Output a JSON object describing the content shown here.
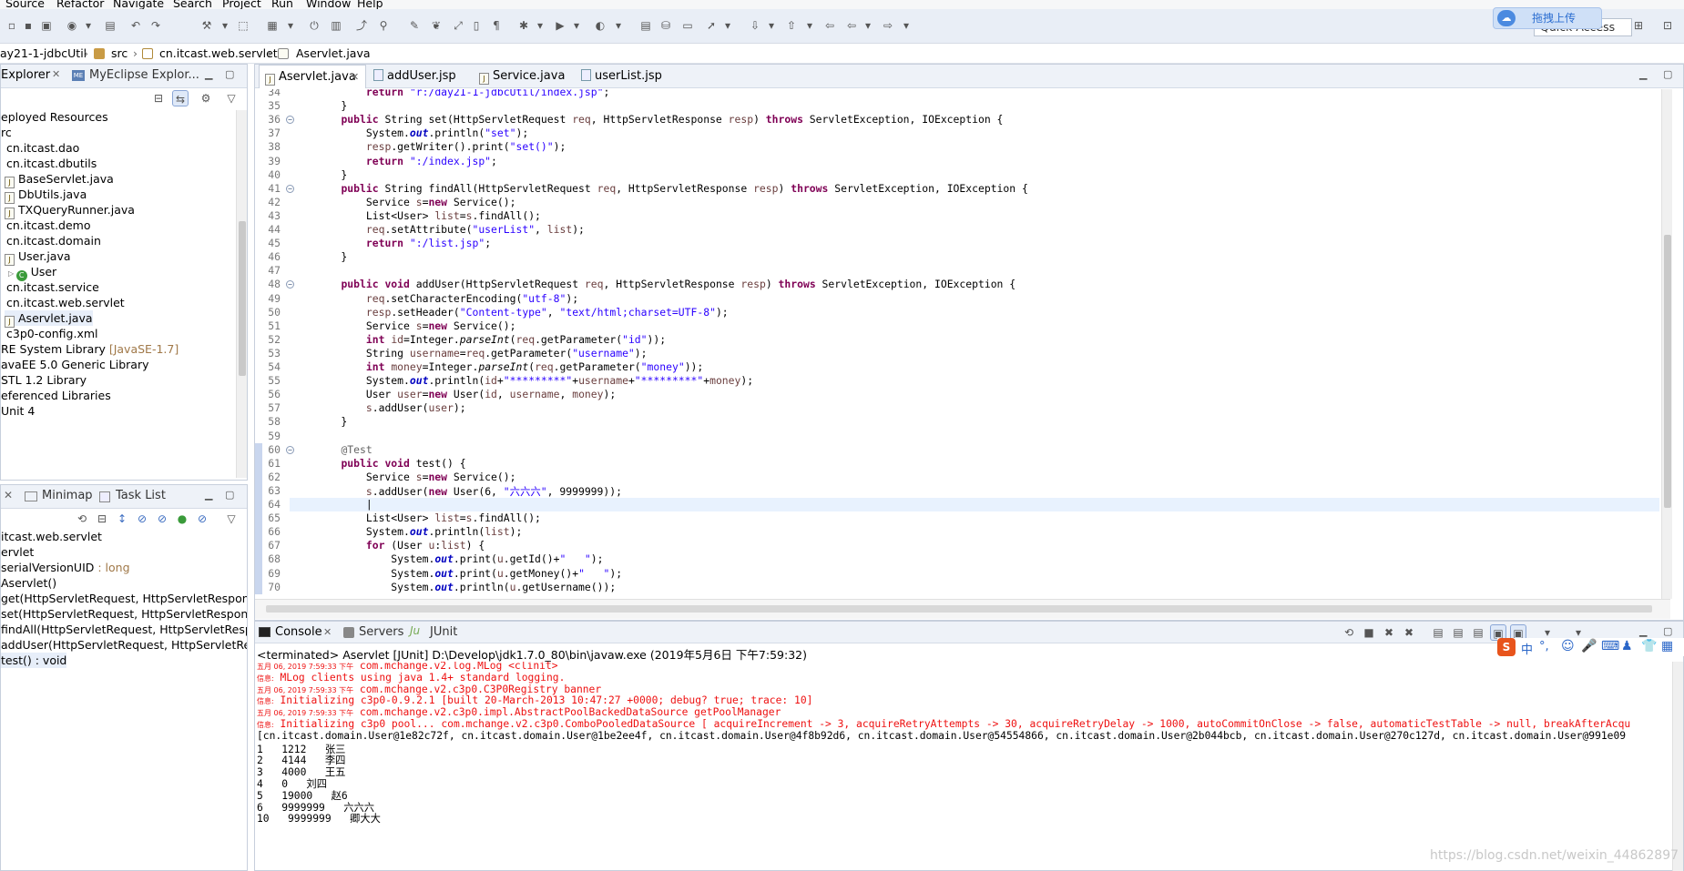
{
  "menu": [
    "Source",
    "Refactor",
    "Navigate",
    "Search",
    "Project",
    "Run",
    "Window",
    "Help"
  ],
  "quick_access": "Quick Access",
  "upload_label": "拖拽上传",
  "breadcrumb": [
    "ay21-1-jdbcUtil",
    "src",
    "cn.itcast.web.servlet",
    "Aservlet.java"
  ],
  "explorer": {
    "tabs": [
      "Explorer",
      "MyEclipse Explor..."
    ],
    "items": [
      {
        "label": "eployed Resources",
        "indent": 0,
        "icon": "none"
      },
      {
        "label": "rc",
        "indent": 0,
        "icon": "none"
      },
      {
        "label": "cn.itcast.dao",
        "indent": 6,
        "icon": "none"
      },
      {
        "label": "cn.itcast.dbutils",
        "indent": 6,
        "icon": "none"
      },
      {
        "label": "BaseServlet.java",
        "indent": 4,
        "icon": "java"
      },
      {
        "label": "DbUtils.java",
        "indent": 4,
        "icon": "java"
      },
      {
        "label": "TXQueryRunner.java",
        "indent": 4,
        "icon": "java"
      },
      {
        "label": "cn.itcast.demo",
        "indent": 6,
        "icon": "none"
      },
      {
        "label": "cn.itcast.domain",
        "indent": 6,
        "icon": "none"
      },
      {
        "label": "User.java",
        "indent": 4,
        "icon": "java"
      },
      {
        "label": "User",
        "indent": 8,
        "icon": "class"
      },
      {
        "label": "cn.itcast.service",
        "indent": 6,
        "icon": "none"
      },
      {
        "label": "cn.itcast.web.servlet",
        "indent": 6,
        "icon": "none"
      },
      {
        "label": "Aservlet.java",
        "indent": 4,
        "icon": "java",
        "selected": true
      },
      {
        "label": "c3p0-config.xml",
        "indent": 6,
        "icon": "none"
      },
      {
        "label": "RE System Library",
        "suffix": " [JavaSE-1.7]",
        "indent": 0,
        "icon": "none"
      },
      {
        "label": "avaEE 5.0 Generic Library",
        "indent": 0,
        "icon": "none"
      },
      {
        "label": "STL 1.2 Library",
        "indent": 0,
        "icon": "none"
      },
      {
        "label": "eferenced Libraries",
        "indent": 0,
        "icon": "none"
      },
      {
        "label": "Unit 4",
        "indent": 0,
        "icon": "none"
      }
    ]
  },
  "outline": {
    "tabs": [
      "Minimap",
      "Task List"
    ],
    "items": [
      {
        "label": "itcast.web.servlet",
        "suffix": ""
      },
      {
        "label": "ervlet",
        "suffix": ""
      },
      {
        "label": "serialVersionUID",
        "suffix": " : long"
      },
      {
        "label": "Aservlet()",
        "suffix": ""
      },
      {
        "label": "get(HttpServletRequest, HttpServletResponse)",
        "suffix": ""
      },
      {
        "label": "set(HttpServletRequest, HttpServletResponse)",
        "suffix": ""
      },
      {
        "label": "findAll(HttpServletRequest, HttpServletRespon",
        "suffix": ""
      },
      {
        "label": "addUser(HttpServletRequest, HttpServletRespo",
        "suffix": ""
      },
      {
        "label": "test() : void",
        "suffix": "",
        "selected": true
      }
    ]
  },
  "editor": {
    "tabs": [
      "Aservlet.java",
      "addUser.jsp",
      "Service.java",
      "userList.jsp"
    ],
    "lines": [
      {
        "n": "34",
        "html": "        <span class='kw'>return</span> <span class='str'>\"r:/day21-1-jdbcUtil/index.jsp\"</span>;"
      },
      {
        "n": "35",
        "html": "    }"
      },
      {
        "n": "36",
        "fold": true,
        "html": "    <span class='kw'>public</span> String set(HttpServletRequest <span class='var'>req</span>, HttpServletResponse <span class='var'>resp</span>) <span class='kw'>throws</span> ServletException, IOException {"
      },
      {
        "n": "37",
        "html": "        System.<span class='fld'>out</span>.println(<span class='str'>\"set\"</span>);"
      },
      {
        "n": "38",
        "html": "        <span class='var'>resp</span>.getWriter().print(<span class='str'>\"set()\"</span>);"
      },
      {
        "n": "39",
        "html": "        <span class='kw'>return</span> <span class='str'>\":/index.jsp\"</span>;"
      },
      {
        "n": "40",
        "html": "    }"
      },
      {
        "n": "41",
        "fold": true,
        "html": "    <span class='kw'>public</span> String findAll(HttpServletRequest <span class='var'>req</span>, HttpServletResponse <span class='var'>resp</span>) <span class='kw'>throws</span> ServletException, IOException {"
      },
      {
        "n": "42",
        "html": "        Service <span class='var'>s</span>=<span class='kw'>new</span> Service();"
      },
      {
        "n": "43",
        "html": "        List&lt;User&gt; <span class='var'>list</span>=<span class='var'>s</span>.findAll();"
      },
      {
        "n": "44",
        "html": "        <span class='var'>req</span>.setAttribute(<span class='str'>\"userList\"</span>, <span class='var'>list</span>);"
      },
      {
        "n": "45",
        "html": "        <span class='kw'>return</span> <span class='str'>\":/list.jsp\"</span>;"
      },
      {
        "n": "46",
        "html": "    }"
      },
      {
        "n": "47",
        "html": ""
      },
      {
        "n": "48",
        "fold": true,
        "html": "    <span class='kw'>public</span> <span class='kw'>void</span> addUser(HttpServletRequest <span class='var'>req</span>, HttpServletResponse <span class='var'>resp</span>) <span class='kw'>throws</span> ServletException, IOException {"
      },
      {
        "n": "49",
        "html": "        <span class='var'>req</span>.setCharacterEncoding(<span class='str'>\"utf-8\"</span>);"
      },
      {
        "n": "50",
        "html": "        <span class='var'>resp</span>.setHeader(<span class='str'>\"Content-type\"</span>, <span class='str'>\"text/html;charset=UTF-8\"</span>);"
      },
      {
        "n": "51",
        "html": "        Service <span class='var'>s</span>=<span class='kw'>new</span> Service();"
      },
      {
        "n": "52",
        "html": "        <span class='kw'>int</span> <span class='var'>id</span>=Integer.<span class='ital'>parseInt</span>(<span class='var'>req</span>.getParameter(<span class='str'>\"id\"</span>));"
      },
      {
        "n": "53",
        "html": "        String <span class='var'>username</span>=<span class='var'>req</span>.getParameter(<span class='str'>\"username\"</span>);"
      },
      {
        "n": "54",
        "html": "        <span class='kw'>int</span> <span class='var'>money</span>=Integer.<span class='ital'>parseInt</span>(<span class='var'>req</span>.getParameter(<span class='str'>\"money\"</span>));"
      },
      {
        "n": "55",
        "html": "        System.<span class='fld'>out</span>.println(<span class='var'>id</span>+<span class='str'>\"*********\"</span>+<span class='var'>username</span>+<span class='str'>\"*********\"</span>+<span class='var'>money</span>);"
      },
      {
        "n": "56",
        "html": "        User <span class='var'>user</span>=<span class='kw'>new</span> User(<span class='var'>id</span>, <span class='var'>username</span>, <span class='var'>money</span>);"
      },
      {
        "n": "57",
        "html": "        <span class='var'>s</span>.addUser(<span class='var'>user</span>);"
      },
      {
        "n": "58",
        "html": "    }"
      },
      {
        "n": "59",
        "html": ""
      },
      {
        "n": "60",
        "fold": true,
        "html": "    <span class='ann'>@Test</span>"
      },
      {
        "n": "61",
        "html": "    <span class='kw'>public</span> <span class='kw'>void</span> test() {"
      },
      {
        "n": "62",
        "html": "        Service <span class='var'>s</span>=<span class='kw'>new</span> Service();"
      },
      {
        "n": "63",
        "html": "        <span class='var'>s</span>.addUser(<span class='kw'>new</span> User(6, <span class='str'>\"六六六\"</span>, 9999999));"
      },
      {
        "n": "64",
        "current": true,
        "html": "        |"
      },
      {
        "n": "65",
        "html": "        List&lt;User&gt; <span class='var'>list</span>=<span class='var'>s</span>.findAll();"
      },
      {
        "n": "66",
        "html": "        System.<span class='fld'>out</span>.println(<span class='var'>list</span>);"
      },
      {
        "n": "67",
        "html": "        <span class='kw'>for</span> (User <span class='var'>u</span>:<span class='var'>list</span>) {"
      },
      {
        "n": "68",
        "html": "            System.<span class='fld'>out</span>.print(<span class='var'>u</span>.getId()+<span class='str'>\"   \"</span>);"
      },
      {
        "n": "69",
        "html": "            System.<span class='fld'>out</span>.print(<span class='var'>u</span>.getMoney()+<span class='str'>\"   \"</span>);"
      },
      {
        "n": "70",
        "html": "            System.<span class='fld'>out</span>.println(<span class='var'>u</span>.getUsername());"
      }
    ]
  },
  "console": {
    "tabs": [
      "Console",
      "Servers",
      "JUnit"
    ],
    "description": "<terminated> Aservlet [JUnit] D:\\Develop\\jdk1.7.0_80\\bin\\javaw.exe (2019年5月6日 下午7:59:32)",
    "lines": [
      {
        "prefix": "五月 06, 2019 7:59:33 下午",
        "text": " com.mchange.v2.log.MLog <clinit>",
        "red": true
      },
      {
        "prefix": "信息:",
        "text": " MLog clients using java 1.4+ standard logging.",
        "red": true
      },
      {
        "prefix": "五月 06, 2019 7:59:33 下午",
        "text": " com.mchange.v2.c3p0.C3P0Registry banner",
        "red": true
      },
      {
        "prefix": "信息:",
        "text": " Initializing c3p0-0.9.2.1 [built 20-March-2013 10:47:27 +0000; debug? true; trace: 10]",
        "red": true
      },
      {
        "prefix": "五月 06, 2019 7:59:33 下午",
        "text": " com.mchange.v2.c3p0.impl.AbstractPoolBackedDataSource getPoolManager",
        "red": true
      },
      {
        "prefix": "信息:",
        "text": " Initializing c3p0 pool... com.mchange.v2.c3p0.ComboPooledDataSource [ acquireIncrement -> 3, acquireRetryAttempts -> 30, acquireRetryDelay -> 1000, autoCommitOnClose -> false, automaticTestTable -> null, breakAfterAcqu",
        "red": true
      },
      {
        "prefix": "",
        "text": "[cn.itcast.domain.User@1e82c72f, cn.itcast.domain.User@1be2ee4f, cn.itcast.domain.User@4f8b92d6, cn.itcast.domain.User@54554866, cn.itcast.domain.User@2b044bcb, cn.itcast.domain.User@270c127d, cn.itcast.domain.User@991e09",
        "red": false
      },
      {
        "prefix": "",
        "text": "1   1212   张三",
        "red": false
      },
      {
        "prefix": "",
        "text": "2   4144   李四",
        "red": false
      },
      {
        "prefix": "",
        "text": "3   4000   王五",
        "red": false
      },
      {
        "prefix": "",
        "text": "4   0   刘四",
        "red": false
      },
      {
        "prefix": "",
        "text": "5   19000   赵6",
        "red": false
      },
      {
        "prefix": "",
        "text": "6   9999999   六六六",
        "red": false
      },
      {
        "prefix": "",
        "text": "10   9999999   卿大大",
        "red": false
      }
    ]
  },
  "watermark": "https://blog.csdn.net/weixin_44862897"
}
